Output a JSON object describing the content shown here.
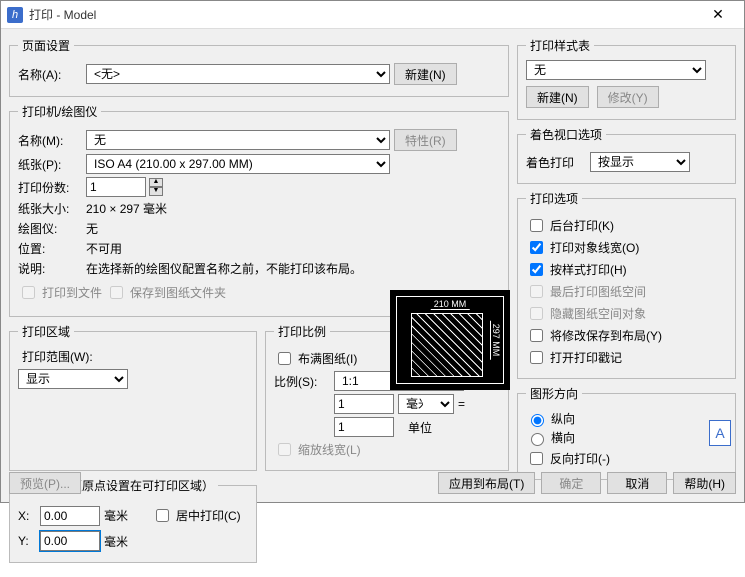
{
  "window": {
    "title": "打印 - Model"
  },
  "page_setup": {
    "legend": "页面设置",
    "name_label": "名称(A):",
    "name_value": "<无>",
    "new_btn": "新建(N)"
  },
  "printer": {
    "legend": "打印机/绘图仪",
    "name_label": "名称(M):",
    "name_value": "无",
    "props_btn": "特性(R)",
    "paper_label": "纸张(P):",
    "paper_value": "ISO A4 (210.00 x 297.00 MM)",
    "copies_label": "打印份数:",
    "copies_value": "1",
    "size_label": "纸张大小:",
    "size_value": "210 × 297  毫米",
    "plotter_label": "绘图仪:",
    "plotter_value": "无",
    "location_label": "位置:",
    "location_value": "不可用",
    "desc_label": "说明:",
    "desc_value": "在选择新的绘图仪配置名称之前，不能打印该布局。",
    "to_file": "打印到文件",
    "save_to_sheet": "保存到图纸文件夹",
    "preview_top": "210 MM",
    "preview_right": "297 MM"
  },
  "area": {
    "legend": "打印区域",
    "range_label": "打印范围(W):",
    "range_value": "显示"
  },
  "scale": {
    "legend": "打印比例",
    "fit": "布满图纸(I)",
    "ratio_label": "比例(S):",
    "ratio_value": "1:1",
    "num1": "1",
    "unit1": "毫米",
    "eq": "=",
    "num2": "1",
    "unit2": "单位",
    "scalelw": "缩放线宽(L)"
  },
  "offset": {
    "legend": "打印偏移（原点设置在可打印区域）",
    "x_label": "X:",
    "x_value": "0.00",
    "y_label": "Y:",
    "y_value": "0.00",
    "mm": "毫米",
    "center": "居中打印(C)"
  },
  "styles": {
    "legend": "打印样式表",
    "value": "无",
    "new_btn": "新建(N)",
    "edit_btn": "修改(Y)"
  },
  "shade": {
    "legend": "着色视口选项",
    "label": "着色打印",
    "value": "按显示"
  },
  "options": {
    "legend": "打印选项",
    "bg": "后台打印(K)",
    "lw": "打印对象线宽(O)",
    "style": "按样式打印(H)",
    "last": "最后打印图纸空间",
    "hide": "隐藏图纸空间对象",
    "save": "将修改保存到布局(Y)",
    "stamp": "打开打印戳记"
  },
  "orient": {
    "legend": "图形方向",
    "portrait": "纵向",
    "landscape": "横向",
    "reverse": "反向打印(-)",
    "icon": "A"
  },
  "buttons": {
    "preview": "预览(P)...",
    "apply": "应用到布局(T)",
    "ok": "确定",
    "cancel": "取消",
    "help": "帮助(H)"
  }
}
